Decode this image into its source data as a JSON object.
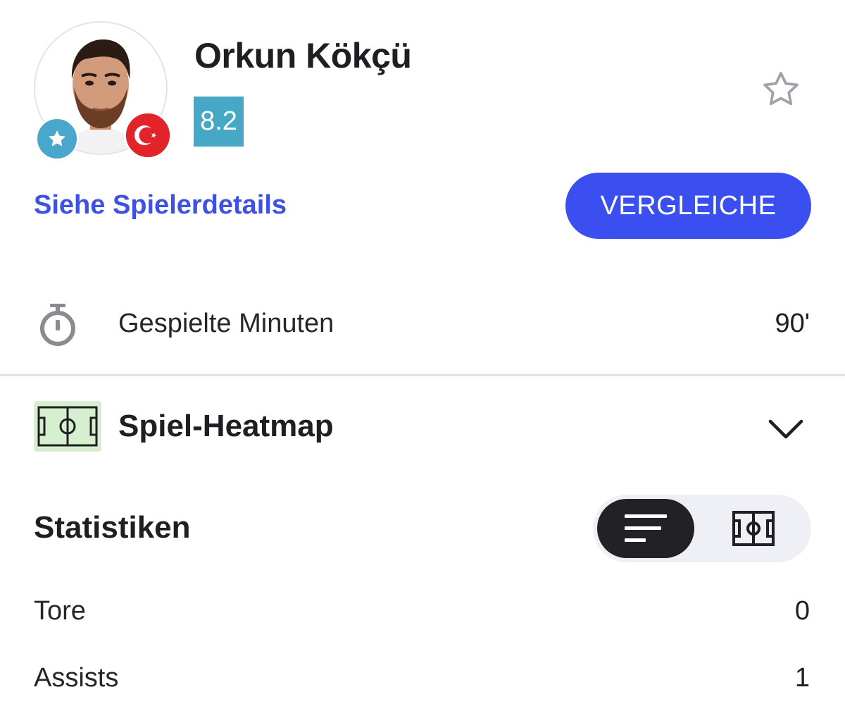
{
  "player": {
    "name": "Orkun Kökçü",
    "rating": "8.2",
    "nationality_flag": "turkey-flag-icon",
    "position_badge": "star-icon"
  },
  "actions": {
    "details_link": "Siehe Spielerdetails",
    "compare_button": "VERGLEICHE",
    "favorite_icon": "star-outline-icon"
  },
  "minutes": {
    "icon": "stopwatch-icon",
    "label": "Gespielte Minuten",
    "value": "90'"
  },
  "heatmap": {
    "icon": "pitch-icon",
    "title": "Spiel-Heatmap",
    "toggle_icon": "chevron-down-icon"
  },
  "statistics": {
    "title": "Statistiken",
    "view_options": [
      "list-view-icon",
      "pitch-view-icon"
    ],
    "selected_view": "list-view-icon",
    "rows": [
      {
        "label": "Tore",
        "value": "0"
      },
      {
        "label": "Assists",
        "value": "1"
      }
    ]
  },
  "colors": {
    "accent": "#3b4ff0",
    "link": "#3d51e4",
    "rating_bg": "#47a8c6",
    "flag_red": "#e2232a",
    "heatmap_icon_bg": "#d5efcf",
    "toggle_active": "#222226",
    "toggle_bg": "#eff0f5"
  }
}
